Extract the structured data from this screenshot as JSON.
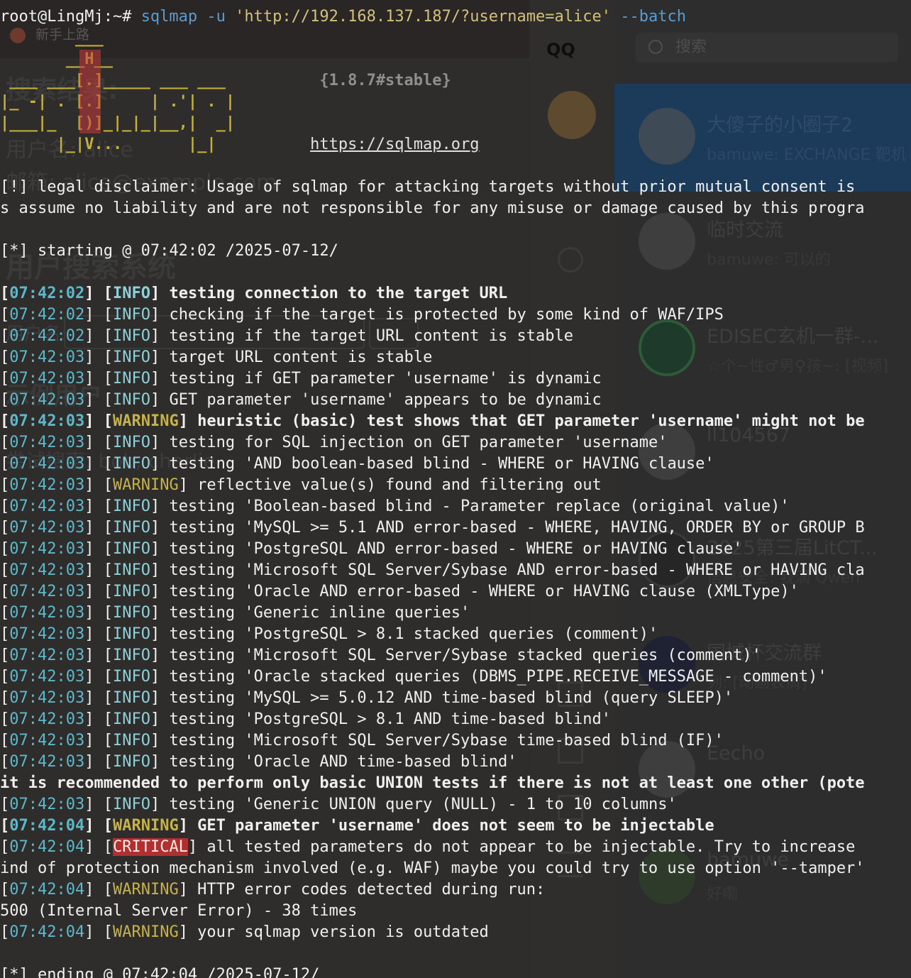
{
  "terminal": {
    "prompt": "root@LingMj:~# ",
    "cmd": "sqlmap",
    "flag_u": "-u",
    "url": "'http://192.168.137.187/?username=alice'",
    "flag_batch": "--batch",
    "logo": {
      "line1": "        ___",
      "line2": "       __H__",
      "line3": " ___ ___[.]_____ ___ ___  ",
      "version": "{1.8.7#stable}",
      "line4": "|_ -| . [.]     | .'| . |",
      "line5": "|___|_  [)]_|_|_|__,|  _|",
      "line6": "      |_|V...       |_|   ",
      "site": "https://sqlmap.org"
    },
    "disclaimer1": "[!] legal disclaimer: Usage of sqlmap for attacking targets without prior mutual consent is",
    "disclaimer2": "s assume no liability and are not responsible for any misuse or damage caused by this progra",
    "starting": "[*] starting @ 07:42:02 /2025-07-12/",
    "lines": [
      {
        "ts": "07:42:02",
        "lvl": "INFO",
        "msg": " testing connection to the target URL",
        "bold": true
      },
      {
        "ts": "07:42:02",
        "lvl": "INFO",
        "msg": " checking if the target is protected by some kind of WAF/IPS",
        "bold": false
      },
      {
        "ts": "07:42:02",
        "lvl": "INFO",
        "msg": " testing if the target URL content is stable",
        "bold": false
      },
      {
        "ts": "07:42:03",
        "lvl": "INFO",
        "msg": " target URL content is stable",
        "bold": false
      },
      {
        "ts": "07:42:03",
        "lvl": "INFO",
        "msg": " testing if GET parameter 'username' is dynamic",
        "bold": false
      },
      {
        "ts": "07:42:03",
        "lvl": "INFO",
        "msg": " GET parameter 'username' appears to be dynamic",
        "bold": false
      },
      {
        "ts": "07:42:03",
        "lvl": "WARNING",
        "msg": " heuristic (basic) test shows that GET parameter 'username' might not be",
        "bold": true
      },
      {
        "ts": "07:42:03",
        "lvl": "INFO",
        "msg": " testing for SQL injection on GET parameter 'username'",
        "bold": false
      },
      {
        "ts": "07:42:03",
        "lvl": "INFO",
        "msg": " testing 'AND boolean-based blind - WHERE or HAVING clause'",
        "bold": false
      },
      {
        "ts": "07:42:03",
        "lvl": "WARNING",
        "msg": " reflective value(s) found and filtering out",
        "bold": false
      },
      {
        "ts": "07:42:03",
        "lvl": "INFO",
        "msg": " testing 'Boolean-based blind - Parameter replace (original value)'",
        "bold": false
      },
      {
        "ts": "07:42:03",
        "lvl": "INFO",
        "msg": " testing 'MySQL >= 5.1 AND error-based - WHERE, HAVING, ORDER BY or GROUP B",
        "bold": false
      },
      {
        "ts": "07:42:03",
        "lvl": "INFO",
        "msg": " testing 'PostgreSQL AND error-based - WHERE or HAVING clause'",
        "bold": false
      },
      {
        "ts": "07:42:03",
        "lvl": "INFO",
        "msg": " testing 'Microsoft SQL Server/Sybase AND error-based - WHERE or HAVING cla",
        "bold": false
      },
      {
        "ts": "07:42:03",
        "lvl": "INFO",
        "msg": " testing 'Oracle AND error-based - WHERE or HAVING clause (XMLType)'",
        "bold": false
      },
      {
        "ts": "07:42:03",
        "lvl": "INFO",
        "msg": " testing 'Generic inline queries'",
        "bold": false
      },
      {
        "ts": "07:42:03",
        "lvl": "INFO",
        "msg": " testing 'PostgreSQL > 8.1 stacked queries (comment)'",
        "bold": false
      },
      {
        "ts": "07:42:03",
        "lvl": "INFO",
        "msg": " testing 'Microsoft SQL Server/Sybase stacked queries (comment)'",
        "bold": false
      },
      {
        "ts": "07:42:03",
        "lvl": "INFO",
        "msg": " testing 'Oracle stacked queries (DBMS_PIPE.RECEIVE_MESSAGE - comment)'",
        "bold": false
      },
      {
        "ts": "07:42:03",
        "lvl": "INFO",
        "msg": " testing 'MySQL >= 5.0.12 AND time-based blind (query SLEEP)'",
        "bold": false
      },
      {
        "ts": "07:42:03",
        "lvl": "INFO",
        "msg": " testing 'PostgreSQL > 8.1 AND time-based blind'",
        "bold": false
      },
      {
        "ts": "07:42:03",
        "lvl": "INFO",
        "msg": " testing 'Microsoft SQL Server/Sybase time-based blind (IF)'",
        "bold": false
      },
      {
        "ts": "07:42:03",
        "lvl": "INFO",
        "msg": " testing 'Oracle AND time-based blind'",
        "bold": false
      }
    ],
    "union_note": "it is recommended to perform only basic UNION tests if there is not at least one other (pote",
    "lines2": [
      {
        "ts": "07:42:03",
        "lvl": "INFO",
        "msg": " testing 'Generic UNION query (NULL) - 1 to 10 columns'",
        "bold": false
      },
      {
        "ts": "07:42:04",
        "lvl": "WARNING",
        "msg": " GET parameter 'username' does not seem to be injectable",
        "bold": true
      },
      {
        "ts": "07:42:04",
        "lvl": "CRITICAL",
        "msg": " all tested parameters do not appear to be injectable. Try to increase",
        "bold": false
      }
    ],
    "crit_cont": "ind of protection mechanism involved (e.g. WAF) maybe you could try to use option '--tamper'",
    "lines3": [
      {
        "ts": "07:42:04",
        "lvl": "WARNING",
        "msg": " HTTP error codes detected during run:",
        "bold": false
      }
    ],
    "http_err": "500 (Internal Server Error) - 38 times",
    "lines4": [
      {
        "ts": "07:42:04",
        "lvl": "WARNING",
        "msg": " your sqlmap version is outdated",
        "bold": false
      }
    ],
    "ending": "[*] ending @ 07:42:04 /2025-07-12/"
  },
  "background_browser": {
    "tab": "新手上路",
    "results_title": "搜索结果:",
    "username_row": "用户名: alice",
    "email_row": "邮箱: alice@example.com",
    "system_title": "用户搜索系统",
    "username_label": "用户名:",
    "input_placeholder": "输入用户名",
    "search_button": "搜索",
    "example_title": "示例用户",
    "try_row": "尝试搜索: bob, charlie"
  },
  "background_qq": {
    "logo": "QQ",
    "search_placeholder": "搜索",
    "chats": [
      {
        "name": "大傻子的小圈子2",
        "msg": "bamuwe: EXCHANGE 靶机"
      },
      {
        "name": "临时交流",
        "msg": "bamuwe: 可以的"
      },
      {
        "name": "EDISEC玄机一群-...",
        "msg": "☆个~性♂男♀孩~: [视频]"
      },
      {
        "name": "ll104567",
        "msg": ""
      },
      {
        "name": "2025第三届LitCT...",
        "msg": "信息安全: 我滴 Qwen"
      },
      {
        "name": "国城杯交流群",
        "msg": "列: [动画表情]"
      },
      {
        "name": "Eecho",
        "msg": ""
      },
      {
        "name": "bamuwe",
        "msg": "好嘞"
      }
    ]
  }
}
